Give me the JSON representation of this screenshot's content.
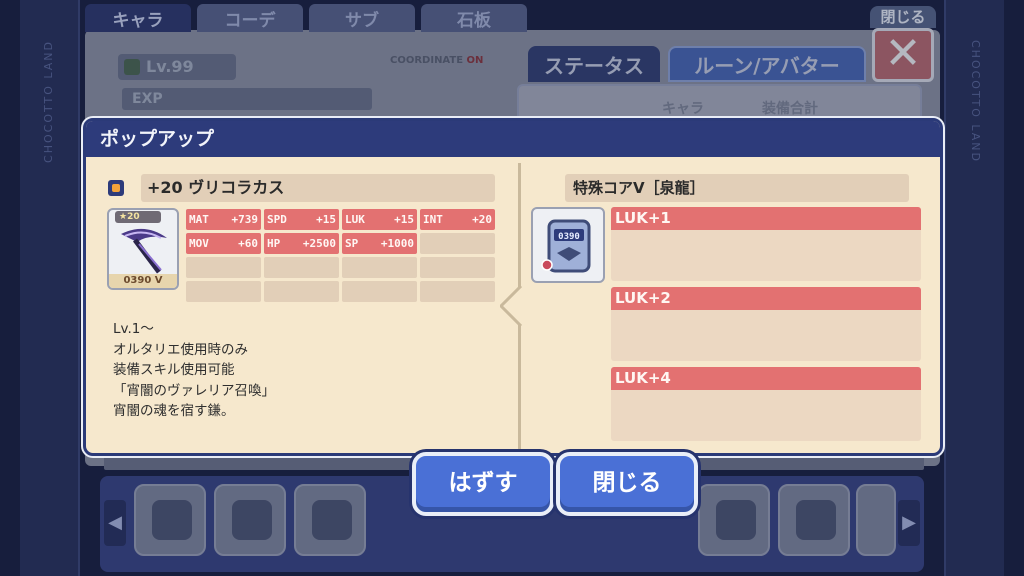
{
  "background": {
    "tabs": [
      "キャラ",
      "コーデ",
      "サブ",
      "石板"
    ],
    "close_label": "閉じる",
    "close_glyph": "✕",
    "level": "Lv.99",
    "exp_label": "EXP",
    "coordinate_label": "COORDINATE",
    "coordinate_state": "ON",
    "right_tabs": [
      "ステータス",
      "ルーン/アバター"
    ],
    "right_header": [
      "キャラ",
      "装備合計"
    ],
    "side_text": "CHOCOTTO LAND",
    "arrow_left": "◀",
    "arrow_right": "▶"
  },
  "popup": {
    "title": "ポップアップ",
    "item": {
      "name": "+20 ヴリコラカス",
      "rank_badge": "★20",
      "code": "0390 Ⅴ",
      "stats": [
        {
          "label": "MAT",
          "value": "+739"
        },
        {
          "label": "SPD",
          "value": "+15"
        },
        {
          "label": "LUK",
          "value": "+15"
        },
        {
          "label": "INT",
          "value": "+20"
        },
        {
          "label": "MOV",
          "value": "+60"
        },
        {
          "label": "HP",
          "value": "+2500"
        },
        {
          "label": "SP",
          "value": "+1000"
        }
      ],
      "description": [
        "Lv.1～",
        "オルタリエ使用時のみ",
        "装備スキル使用可能",
        "「宵闇のヴァレリア召喚」",
        "宵闇の魂を宿す鎌。"
      ]
    },
    "core": {
      "name": "特殊コアⅤ［泉龍］",
      "code": "0390",
      "bonuses": [
        "LUK+1",
        "LUK+2",
        "LUK+4"
      ]
    }
  },
  "buttons": {
    "unequip": "はずす",
    "close": "閉じる"
  },
  "colors": {
    "popup_header": "#2d3b7b",
    "popup_body": "#f6e8cd",
    "stat_filled": "#e37171",
    "button": "#4a70d6"
  }
}
